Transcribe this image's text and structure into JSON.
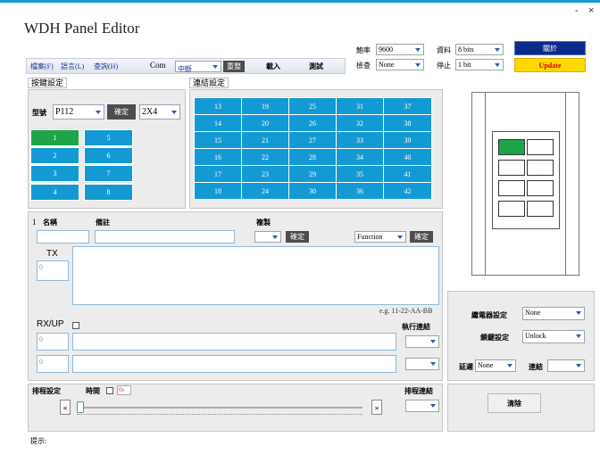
{
  "window": {
    "title": "WDH Panel Editor",
    "minimize": "-",
    "close": "×"
  },
  "menu": {
    "file": "檔案(F)",
    "language": "語言(L)",
    "help": "查詢(H)"
  },
  "com": {
    "label": "Com",
    "value": "中斷",
    "reset": "重整",
    "load": "載入",
    "test": "測試"
  },
  "serial": {
    "baud_label": "鮑率",
    "baud": "9600",
    "data_label": "資料",
    "data": "8 bits",
    "parity_label": "檢查",
    "parity": "None",
    "stop_label": "停止",
    "stop": "1 bit"
  },
  "actions": {
    "connect": "關於",
    "update": "Update"
  },
  "key_settings": {
    "header": "按鍵設定",
    "model_label": "型號",
    "model": "P112",
    "confirm": "確定",
    "layout": "2X4",
    "keys": [
      "1",
      "5",
      "2",
      "6",
      "3",
      "7",
      "4",
      "8"
    ]
  },
  "link_settings": {
    "header": "連結設定",
    "rows": [
      [
        "13",
        "19",
        "25",
        "31",
        "37"
      ],
      [
        "14",
        "20",
        "26",
        "32",
        "38"
      ],
      [
        "15",
        "21",
        "27",
        "33",
        "39"
      ],
      [
        "16",
        "22",
        "28",
        "34",
        "40"
      ],
      [
        "17",
        "23",
        "29",
        "35",
        "41"
      ],
      [
        "18",
        "24",
        "30",
        "36",
        "42"
      ]
    ]
  },
  "editor": {
    "index": "1",
    "name_label": "名稱",
    "note_label": "備註",
    "copy_label": "複製",
    "confirm": "確定",
    "function_value": "Function",
    "tx_label": "TX",
    "tx_num": "0",
    "example": "e.g. 11-22-AA-BB",
    "rxup_label": "RX/UP",
    "exec_link_label": "執行連結",
    "rx1_num": "0",
    "rx2_num": "0"
  },
  "schedule": {
    "label": "排程設定",
    "time_label": "時間",
    "time_value": "0s",
    "link_label": "排程連結",
    "left": "«",
    "right": "»"
  },
  "relay": {
    "relay_label": "繼電器設定",
    "relay_value": "None",
    "lock_label": "鎖鍵設定",
    "lock_value": "Unlock",
    "delay_label": "延遲",
    "delay_value": "None",
    "link_label": "連結",
    "clear": "清除"
  },
  "status": {
    "hint": "提示:"
  },
  "colors": {
    "accent": "#1a9ad6",
    "key": "#139ad4",
    "active": "#1ea54a",
    "update": "#ffd800",
    "connect": "#0b2a8a"
  }
}
